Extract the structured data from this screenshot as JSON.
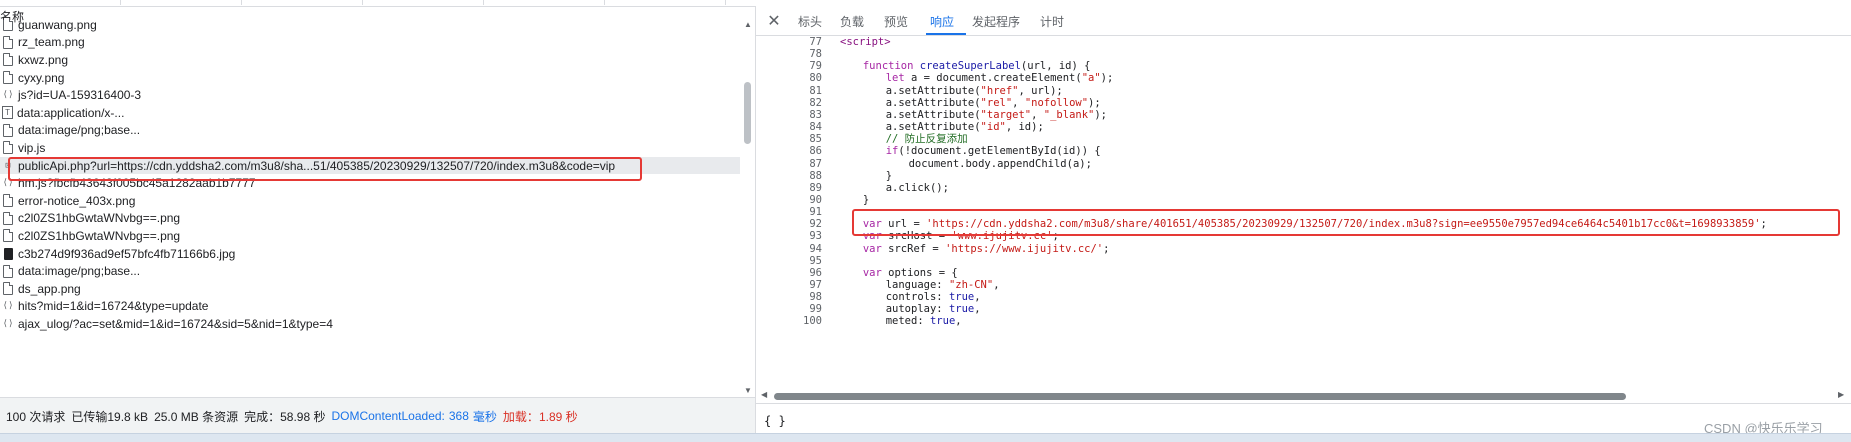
{
  "left_pane": {
    "column_header": "名称",
    "requests": [
      {
        "name": "guanwang.png",
        "icon": "doc-icon"
      },
      {
        "name": "rz_team.png",
        "icon": "doc-icon"
      },
      {
        "name": "kxwz.png",
        "icon": "doc-icon"
      },
      {
        "name": "cyxy.png",
        "icon": "doc-icon"
      },
      {
        "name": "js?id=UA-159316400-3",
        "icon": "script-icon"
      },
      {
        "name": "data:application/x-...",
        "icon": "font-icon"
      },
      {
        "name": "data:image/png;base...",
        "icon": "doc-icon"
      },
      {
        "name": "vip.js",
        "icon": "doc-icon"
      },
      {
        "name": "publicApi.php?url=https://cdn.yddsha2.com/m3u8/sha...51/405385/20230929/132507/720/index.m3u8&code=vip",
        "icon": "xhr-icon",
        "selected": true
      },
      {
        "name": "hm.js?fbcfb43643f005bc45a1282aab1b7777",
        "icon": "script-icon"
      },
      {
        "name": "error-notice_403x.png",
        "icon": "doc-icon"
      },
      {
        "name": "c2l0ZS1hbGwtaWNvbg==.png",
        "icon": "doc-icon"
      },
      {
        "name": "c2l0ZS1hbGwtaWNvbg==.png",
        "icon": "doc-icon"
      },
      {
        "name": "c3b274d9f936ad9ef57bfc4fb71166b6.jpg",
        "icon": "image-icon"
      },
      {
        "name": "data:image/png;base...",
        "icon": "doc-icon"
      },
      {
        "name": "ds_app.png",
        "icon": "doc-icon"
      },
      {
        "name": "hits?mid=1&id=16724&type=update",
        "icon": "script-icon"
      },
      {
        "name": "ajax_ulog/?ac=set&mid=1&id=16724&sid=5&nid=1&type=4",
        "icon": "script-icon"
      }
    ],
    "status": {
      "requests": "100 次请求",
      "transferred": "已传输19.8 kB",
      "resources": "25.0 MB 条资源",
      "finish": "完成：58.98 秒",
      "dom_label": "DOMContentLoaded:",
      "dom_value": "368",
      "dom_unit": "毫秒",
      "load_label": "加载：",
      "load_value": "1.89 秒"
    }
  },
  "right_pane": {
    "tabs": [
      "标头",
      "负载",
      "预览",
      "响应",
      "发起程序",
      "计时"
    ],
    "active_tab": "响应",
    "code_lines": [
      {
        "n": "77",
        "segs": [
          {
            "t": "<script>",
            "c": "tag"
          }
        ],
        "indent": 2
      },
      {
        "n": "78",
        "segs": [],
        "indent": 0
      },
      {
        "n": "79",
        "segs": [
          {
            "t": "function ",
            "c": "kw"
          },
          {
            "t": "createSuperLabel",
            "c": "fn"
          },
          {
            "t": "(url, id) {",
            "c": ""
          }
        ],
        "indent": 4
      },
      {
        "n": "80",
        "segs": [
          {
            "t": "let ",
            "c": "kw"
          },
          {
            "t": "a = document.createElement(",
            "c": ""
          },
          {
            "t": "\"a\"",
            "c": "str"
          },
          {
            "t": ");",
            "c": ""
          }
        ],
        "indent": 6
      },
      {
        "n": "81",
        "segs": [
          {
            "t": "a.setAttribute(",
            "c": ""
          },
          {
            "t": "\"href\"",
            "c": "str"
          },
          {
            "t": ", url);",
            "c": ""
          }
        ],
        "indent": 6
      },
      {
        "n": "82",
        "segs": [
          {
            "t": "a.setAttribute(",
            "c": ""
          },
          {
            "t": "\"rel\"",
            "c": "str"
          },
          {
            "t": ", ",
            "c": ""
          },
          {
            "t": "\"nofollow\"",
            "c": "str"
          },
          {
            "t": ");",
            "c": ""
          }
        ],
        "indent": 6
      },
      {
        "n": "83",
        "segs": [
          {
            "t": "a.setAttribute(",
            "c": ""
          },
          {
            "t": "\"target\"",
            "c": "str"
          },
          {
            "t": ", ",
            "c": ""
          },
          {
            "t": "\"_blank\"",
            "c": "str"
          },
          {
            "t": ");",
            "c": ""
          }
        ],
        "indent": 6
      },
      {
        "n": "84",
        "segs": [
          {
            "t": "a.setAttribute(",
            "c": ""
          },
          {
            "t": "\"id\"",
            "c": "str"
          },
          {
            "t": ", id);",
            "c": ""
          }
        ],
        "indent": 6
      },
      {
        "n": "85",
        "segs": [
          {
            "t": "// 防止反复添加",
            "c": "cm"
          }
        ],
        "indent": 6
      },
      {
        "n": "86",
        "segs": [
          {
            "t": "if",
            "c": "kw"
          },
          {
            "t": "(!document.getElementById(id)) {",
            "c": ""
          }
        ],
        "indent": 6
      },
      {
        "n": "87",
        "segs": [
          {
            "t": "document.body.appendChild(a);",
            "c": ""
          }
        ],
        "indent": 8
      },
      {
        "n": "88",
        "segs": [
          {
            "t": "}",
            "c": ""
          }
        ],
        "indent": 6
      },
      {
        "n": "89",
        "segs": [
          {
            "t": "a.click();",
            "c": ""
          }
        ],
        "indent": 6
      },
      {
        "n": "90",
        "segs": [
          {
            "t": "}",
            "c": ""
          }
        ],
        "indent": 4
      },
      {
        "n": "91",
        "segs": [],
        "indent": 0
      },
      {
        "n": "92",
        "segs": [
          {
            "t": "var ",
            "c": "kw"
          },
          {
            "t": "url = ",
            "c": ""
          },
          {
            "t": "'https://cdn.yddsha2.com/m3u8/share/401651/405385/20230929/132507/720/index.m3u8?sign=ee9550e7957ed94ce6464c5401b17cc0&t=1698933859'",
            "c": "str"
          },
          {
            "t": ";",
            "c": ""
          }
        ],
        "indent": 4
      },
      {
        "n": "93",
        "segs": [
          {
            "t": "var ",
            "c": "kw"
          },
          {
            "t": "srcHost = ",
            "c": ""
          },
          {
            "t": "'www.ijujitv.cc'",
            "c": "str"
          },
          {
            "t": ";",
            "c": ""
          }
        ],
        "indent": 4
      },
      {
        "n": "94",
        "segs": [
          {
            "t": "var ",
            "c": "kw"
          },
          {
            "t": "srcRef = ",
            "c": ""
          },
          {
            "t": "'https://www.ijujitv.cc/'",
            "c": "str"
          },
          {
            "t": ";",
            "c": ""
          }
        ],
        "indent": 4
      },
      {
        "n": "95",
        "segs": [],
        "indent": 0
      },
      {
        "n": "96",
        "segs": [
          {
            "t": "var ",
            "c": "kw"
          },
          {
            "t": "options = {",
            "c": ""
          }
        ],
        "indent": 4
      },
      {
        "n": "97",
        "segs": [
          {
            "t": "language: ",
            "c": ""
          },
          {
            "t": "\"zh-CN\"",
            "c": "str"
          },
          {
            "t": ",",
            "c": ""
          }
        ],
        "indent": 6
      },
      {
        "n": "98",
        "segs": [
          {
            "t": "controls: ",
            "c": ""
          },
          {
            "t": "true",
            "c": "lit"
          },
          {
            "t": ",",
            "c": ""
          }
        ],
        "indent": 6
      },
      {
        "n": "99",
        "segs": [
          {
            "t": "autoplay: ",
            "c": ""
          },
          {
            "t": "true",
            "c": "lit"
          },
          {
            "t": ",",
            "c": ""
          }
        ],
        "indent": 6
      },
      {
        "n": "100",
        "segs": [
          {
            "t": "meted: ",
            "c": ""
          },
          {
            "t": "true",
            "c": "lit"
          },
          {
            "t": ",",
            "c": ""
          }
        ],
        "indent": 6
      }
    ],
    "bottom_text": "{ }",
    "watermark": "CSDN @快乐乐学习"
  },
  "colors": {
    "accent": "#1a73e8",
    "highlight_box": "#e53935",
    "load_time": "#d93025"
  }
}
